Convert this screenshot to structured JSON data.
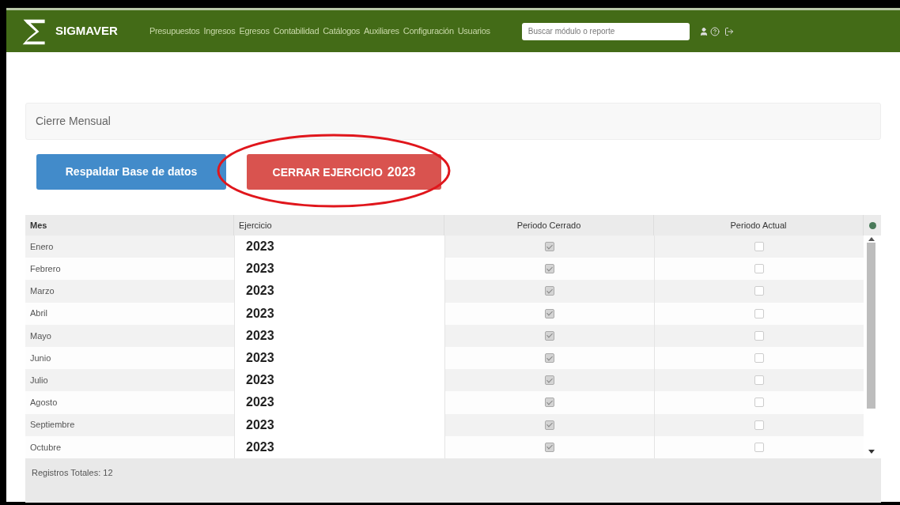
{
  "navbar": {
    "brand": "SIGMAVER",
    "menu": [
      "Presupuestos",
      "Ingresos",
      "Egresos",
      "Contabilidad",
      "Catálogos",
      "Auxiliares",
      "Configuración",
      "Usuarios"
    ],
    "search": {
      "placeholder": "Buscar módulo o reporte"
    }
  },
  "panel": {
    "title": "Cierre Mensual"
  },
  "buttons": [
    {
      "label": "Respaldar Base de datos",
      "kind": "primary",
      "highlighted": false
    },
    {
      "label": "CERRAR EJERCICIO",
      "year": "2023",
      "kind": "danger",
      "highlighted": true
    }
  ],
  "table": {
    "columns": [
      "Mes",
      "Ejercicio",
      "Periodo Cerrado",
      "Periodo Actual"
    ],
    "rows": [
      {
        "mes": "Enero",
        "ejercicio": "2023",
        "cerrado": true,
        "actual": false
      },
      {
        "mes": "Febrero",
        "ejercicio": "2023",
        "cerrado": true,
        "actual": false
      },
      {
        "mes": "Marzo",
        "ejercicio": "2023",
        "cerrado": true,
        "actual": false
      },
      {
        "mes": "Abril",
        "ejercicio": "2023",
        "cerrado": true,
        "actual": false
      },
      {
        "mes": "Mayo",
        "ejercicio": "2023",
        "cerrado": true,
        "actual": false
      },
      {
        "mes": "Junio",
        "ejercicio": "2023",
        "cerrado": true,
        "actual": false
      },
      {
        "mes": "Julio",
        "ejercicio": "2023",
        "cerrado": true,
        "actual": false
      },
      {
        "mes": "Agosto",
        "ejercicio": "2023",
        "cerrado": true,
        "actual": false
      },
      {
        "mes": "Septiembre",
        "ejercicio": "2023",
        "cerrado": true,
        "actual": false
      },
      {
        "mes": "Octubre",
        "ejercicio": "2023",
        "cerrado": true,
        "actual": false
      }
    ],
    "footer": "Registros Totales: 12"
  }
}
